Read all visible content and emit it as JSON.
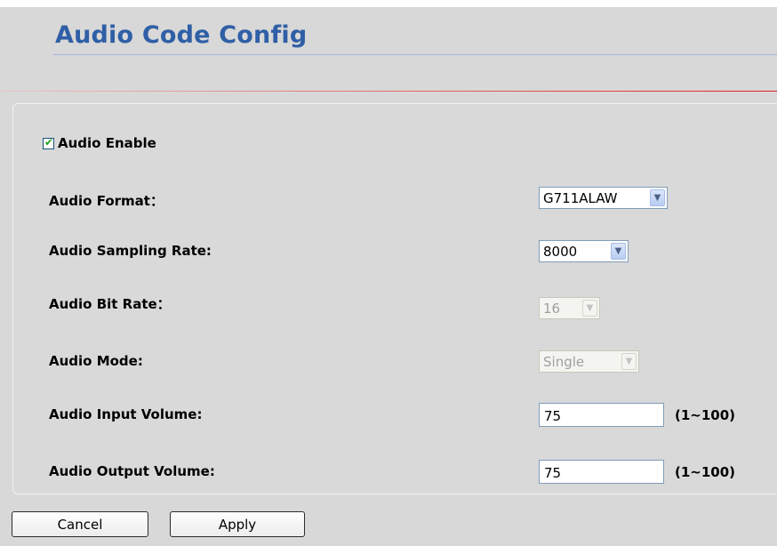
{
  "page": {
    "title": "Audio Code Config"
  },
  "form": {
    "audio_enable": {
      "label": "Audio Enable",
      "checked": true
    },
    "audio_format": {
      "label": "Audio Format：",
      "value": "G711ALAW"
    },
    "sampling_rate": {
      "label": "Audio Sampling Rate:",
      "value": "8000"
    },
    "bit_rate": {
      "label": "Audio Bit Rate：",
      "value": "16"
    },
    "mode": {
      "label": "Audio Mode:",
      "value": "Single"
    },
    "input_volume": {
      "label": "Audio Input Volume:",
      "value": "75",
      "range": "(1~100)"
    },
    "output_volume": {
      "label": "Audio Output Volume:",
      "value": "75",
      "range": "(1~100)"
    }
  },
  "buttons": {
    "cancel": "Cancel",
    "apply": "Apply"
  },
  "colors": {
    "title": "#2f5fa6",
    "background": "#d8d8d8",
    "divider": "#e02020"
  }
}
